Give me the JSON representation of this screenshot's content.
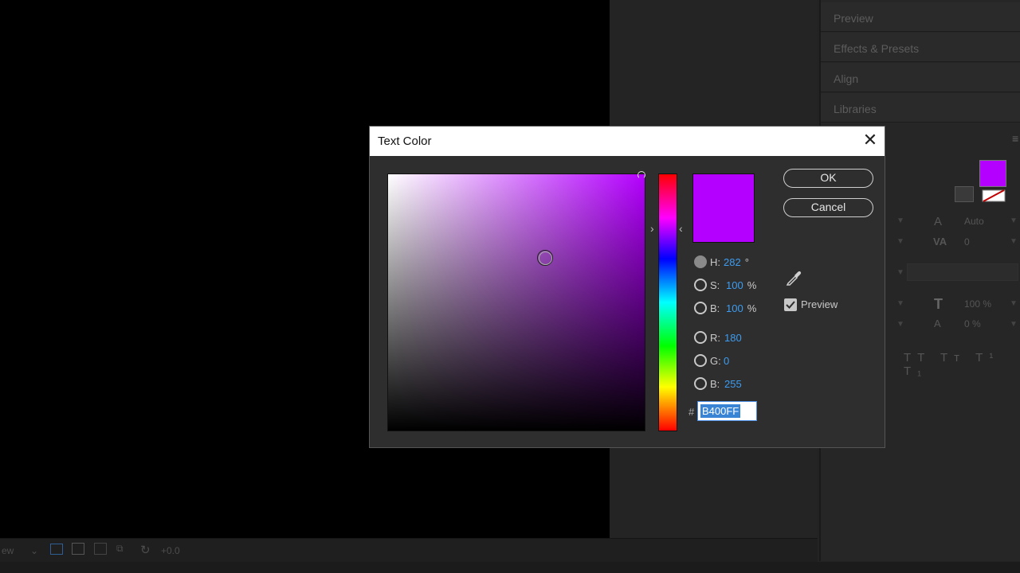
{
  "right_panel": {
    "items": [
      "Preview",
      "Effects & Presets",
      "Align",
      "Libraries"
    ]
  },
  "character_panel": {
    "leading_value": "Auto",
    "tracking_value": "0",
    "vertical_scale": "100 %",
    "baseline_shift": "0 %",
    "fill_color": "#b400ff"
  },
  "status_bar": {
    "view_label": "ew",
    "exposure_value": "+0.0"
  },
  "dialog": {
    "title": "Text Color",
    "close_glyph": "✕",
    "ok_label": "OK",
    "cancel_label": "Cancel",
    "preview_label": "Preview",
    "preview_checked": true,
    "current_color": "#b400ff",
    "fields": [
      {
        "key": "H",
        "label": "H:",
        "value": "282",
        "unit": "°",
        "selected": true
      },
      {
        "key": "S",
        "label": "S:",
        "value": "100",
        "unit": "%",
        "selected": false
      },
      {
        "key": "B",
        "label": "B:",
        "value": "100",
        "unit": "%",
        "selected": false
      },
      {
        "key": "R",
        "label": "R:",
        "value": "180",
        "unit": "",
        "selected": false
      },
      {
        "key": "G",
        "label": "G:",
        "value": "0",
        "unit": "",
        "selected": false
      },
      {
        "key": "Bl",
        "label": "B:",
        "value": "255",
        "unit": "",
        "selected": false
      }
    ],
    "hash_label": "#",
    "hex_value": "B400FF"
  }
}
